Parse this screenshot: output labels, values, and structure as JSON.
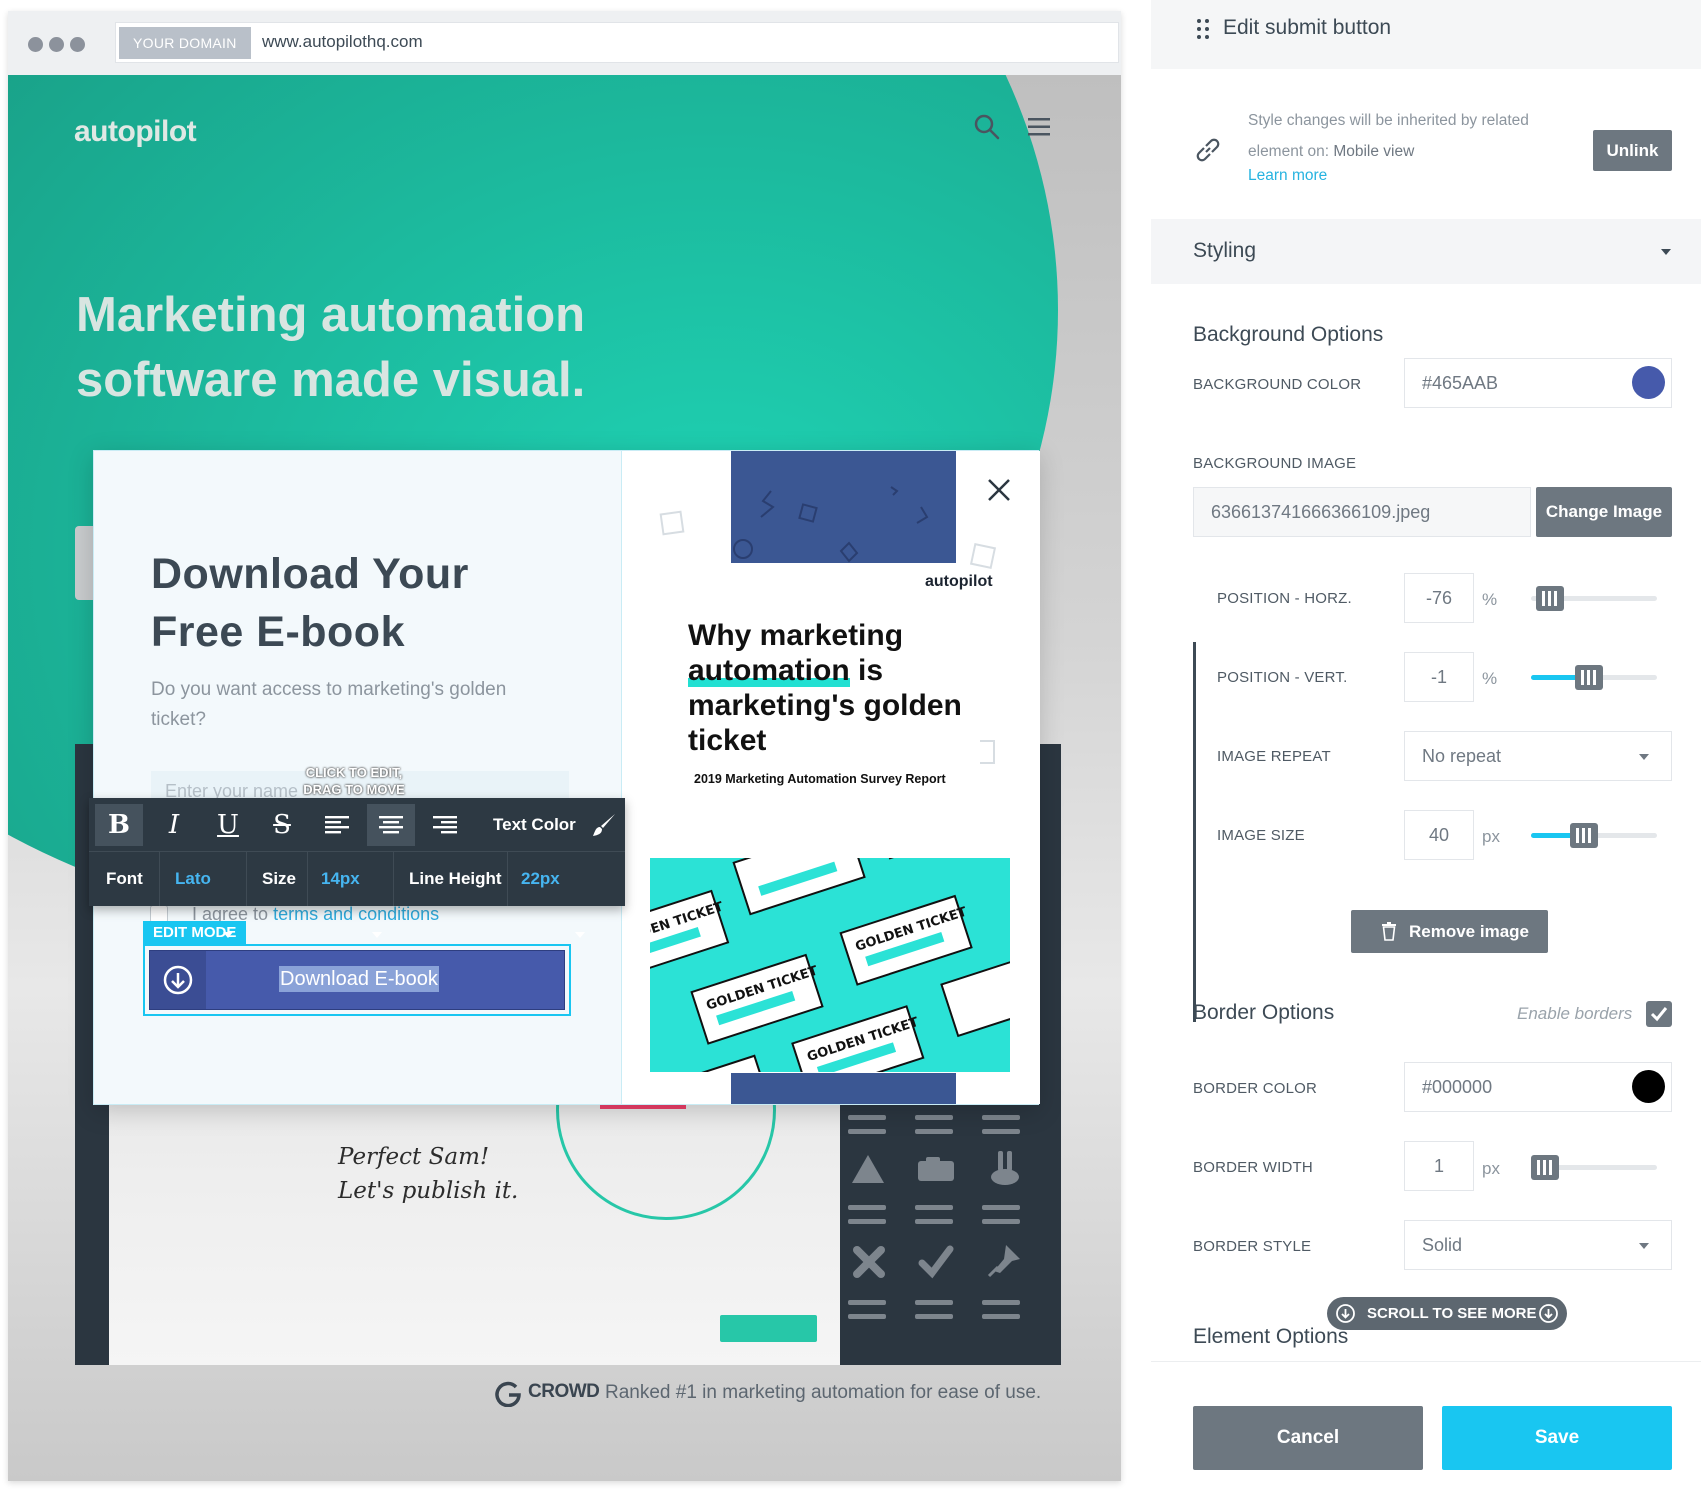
{
  "browser": {
    "domain_badge": "YOUR DOMAIN",
    "url": "www.autopilothq.com"
  },
  "site": {
    "logo": "autopilot",
    "hero_line1": "Marketing automation",
    "hero_line2": "software made visual.",
    "handwrite_line1": "Perfect Sam!",
    "handwrite_line2": "Let's publish it.",
    "g2_brand": "CROWD",
    "g2_text": "Ranked #1 in marketing automation for ease of use."
  },
  "modal": {
    "title": "Download Your Free E-book",
    "subtitle": "Do you want access to marketing's golden ticket?",
    "name_placeholder": "Enter your name",
    "click_hint_1": "CLICK TO EDIT,",
    "click_hint_2": "DRAG TO MOVE",
    "terms_prefix": "I agree to",
    "terms_link": "terms and conditions",
    "edit_mode_badge": "EDIT MODE",
    "submit_label": "Download E-book",
    "ebook": {
      "brand": "autopilot",
      "title_pre": "Why marketing",
      "title_hl": "automation",
      "title_mid": " is marketing's golden ticket",
      "report": "2019 Marketing Automation Survey Report",
      "ticket_text": "GOLDEN TICKET"
    }
  },
  "toolbar": {
    "text_color_label": "Text Color",
    "font_label": "Font",
    "font_value": "Lato",
    "size_label": "Size",
    "size_value": "14px",
    "line_height_label": "Line Height",
    "line_height_value": "22px"
  },
  "panel": {
    "title": "Edit submit button",
    "inherit_text": "Style changes will be inherited by related element on:",
    "inherit_target": "Mobile view",
    "learn_more": "Learn more",
    "unlink": "Unlink",
    "styling": "Styling",
    "background_options": "Background Options",
    "bg_color_label": "BACKGROUND COLOR",
    "bg_color_value": "#465AAB",
    "bg_image_label": "BACKGROUND IMAGE",
    "bg_image_value": "636613741666366109.jpeg",
    "change_image": "Change Image",
    "pos_horz_label": "POSITION - HORZ.",
    "pos_horz_value": "-76",
    "pos_horz_unit": "%",
    "pos_horz_level": 0.05,
    "pos_vert_label": "POSITION - VERT.",
    "pos_vert_value": "-1",
    "pos_vert_unit": "%",
    "pos_vert_level": 0.45,
    "image_repeat_label": "IMAGE REPEAT",
    "image_repeat_value": "No repeat",
    "image_size_label": "IMAGE SIZE",
    "image_size_value": "40",
    "image_size_unit": "px",
    "image_size_level": 0.4,
    "remove_image": "Remove image",
    "border_options": "Border Options",
    "enable_borders": "Enable borders",
    "enable_borders_checked": true,
    "border_color_label": "BORDER COLOR",
    "border_color_value": "#000000",
    "border_width_label": "BORDER WIDTH",
    "border_width_value": "1",
    "border_width_unit": "px",
    "border_width_level": 0.0,
    "border_style_label": "BORDER STYLE",
    "border_style_value": "Solid",
    "scroll_more": "SCROLL TO SEE MORE",
    "element_options": "Element Options",
    "cancel": "Cancel",
    "save": "Save"
  },
  "colors": {
    "accent": "#19C6F1",
    "button_grey": "#6D7780",
    "submit_bg": "#465AAB",
    "teal": "#1FD3B4"
  }
}
